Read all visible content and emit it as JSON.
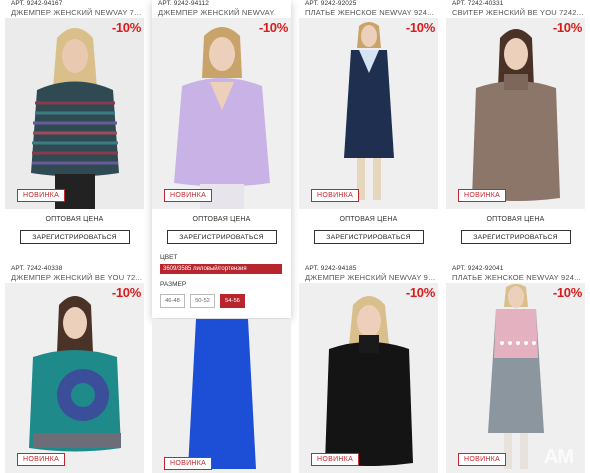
{
  "products": [
    {
      "art": "АРТ. 9242-94167",
      "name": "ДЖЕМПЕР ЖЕНСКИЙ NEWVAY 72...",
      "discount": "-10%",
      "badge": "НОВИНКА",
      "price_label": "ОПТОВАЯ ЦЕНА",
      "register": "ЗАРЕГИСТРИРОВАТЬСЯ"
    },
    {
      "art": "АРТ. 9242-94112",
      "name": "ДЖЕМПЕР ЖЕНСКИЙ NEWVAY",
      "discount": "-10%",
      "badge": "НОВИНКА",
      "price_label": "ОПТОВАЯ ЦЕНА",
      "register": "ЗАРЕГИСТРИРОВАТЬСЯ",
      "color_label": "ЦВЕТ",
      "color_value": "3609/3585 лиловый/гортензия",
      "size_label": "РАЗМЕР",
      "sizes": [
        "46-48",
        "50-52",
        "54-56"
      ]
    },
    {
      "art": "АРТ. 9242-92025",
      "name": "ПЛАТЬЕ ЖЕНСКОЕ NEWVAY 924...",
      "discount": "-10%",
      "badge": "НОВИНКА",
      "price_label": "ОПТОВАЯ ЦЕНА",
      "register": "ЗАРЕГИСТРИРОВАТЬСЯ"
    },
    {
      "art": "АРТ. 7242-40331",
      "name": "СВИТЕР ЖЕНСКИЙ BE YOU 7242...",
      "discount": "-10%",
      "badge": "НОВИНКА",
      "price_label": "ОПТОВАЯ ЦЕНА",
      "register": "ЗАРЕГИСТРИРОВАТЬСЯ"
    },
    {
      "art": "АРТ. 7242-40338",
      "name": "ДЖЕМПЕР ЖЕНСКИЙ BE YOU 72...",
      "discount": "-10%",
      "badge": "НОВИНКА"
    },
    {
      "badge": "НОВИНКА"
    },
    {
      "art": "АРТ. 9242-94185",
      "name": "ДЖЕМПЕР ЖЕНСКИЙ NEWVAY 924...",
      "discount": "-10%",
      "badge": "НОВИНКА"
    },
    {
      "art": "АРТ. 9242-92041",
      "name": "ПЛАТЬЕ ЖЕНСКОЕ NEWVAY 924...",
      "discount": "-10%",
      "badge": "НОВИНКА"
    }
  ],
  "watermark": "AM",
  "colors": {
    "accent": "#c1272d",
    "discount": "#d61c1c",
    "selected": "#b7262c"
  }
}
